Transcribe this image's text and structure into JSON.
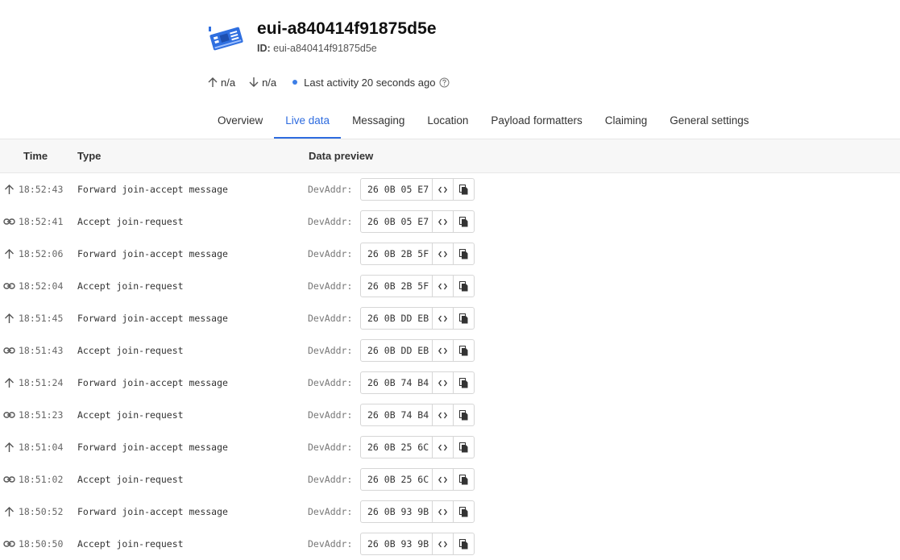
{
  "device": {
    "title": "eui-a840414f91875d5e",
    "id_label": "ID:",
    "id_value": "eui-a840414f91875d5e",
    "icon": "device-board-icon"
  },
  "stats": {
    "uplink": "n/a",
    "downlink": "n/a",
    "last_activity": "Last activity 20 seconds ago"
  },
  "tabs": [
    {
      "label": "Overview",
      "active": false
    },
    {
      "label": "Live data",
      "active": true
    },
    {
      "label": "Messaging",
      "active": false
    },
    {
      "label": "Location",
      "active": false
    },
    {
      "label": "Payload formatters",
      "active": false
    },
    {
      "label": "Claiming",
      "active": false
    },
    {
      "label": "General settings",
      "active": false
    }
  ],
  "table": {
    "headers": {
      "time": "Time",
      "type": "Type",
      "preview": "Data preview"
    },
    "rows": [
      {
        "icon": "arrow-up-icon",
        "time": "18:52:43",
        "type": "Forward join-accept message",
        "label": "DevAddr:",
        "addr": "26 0B 05 E7"
      },
      {
        "icon": "link-icon",
        "time": "18:52:41",
        "type": "Accept join-request",
        "label": "DevAddr:",
        "addr": "26 0B 05 E7"
      },
      {
        "icon": "arrow-up-icon",
        "time": "18:52:06",
        "type": "Forward join-accept message",
        "label": "DevAddr:",
        "addr": "26 0B 2B 5F"
      },
      {
        "icon": "link-icon",
        "time": "18:52:04",
        "type": "Accept join-request",
        "label": "DevAddr:",
        "addr": "26 0B 2B 5F"
      },
      {
        "icon": "arrow-up-icon",
        "time": "18:51:45",
        "type": "Forward join-accept message",
        "label": "DevAddr:",
        "addr": "26 0B DD EB"
      },
      {
        "icon": "link-icon",
        "time": "18:51:43",
        "type": "Accept join-request",
        "label": "DevAddr:",
        "addr": "26 0B DD EB"
      },
      {
        "icon": "arrow-up-icon",
        "time": "18:51:24",
        "type": "Forward join-accept message",
        "label": "DevAddr:",
        "addr": "26 0B 74 B4"
      },
      {
        "icon": "link-icon",
        "time": "18:51:23",
        "type": "Accept join-request",
        "label": "DevAddr:",
        "addr": "26 0B 74 B4"
      },
      {
        "icon": "arrow-up-icon",
        "time": "18:51:04",
        "type": "Forward join-accept message",
        "label": "DevAddr:",
        "addr": "26 0B 25 6C"
      },
      {
        "icon": "link-icon",
        "time": "18:51:02",
        "type": "Accept join-request",
        "label": "DevAddr:",
        "addr": "26 0B 25 6C"
      },
      {
        "icon": "arrow-up-icon",
        "time": "18:50:52",
        "type": "Forward join-accept message",
        "label": "DevAddr:",
        "addr": "26 0B 93 9B"
      },
      {
        "icon": "link-icon",
        "time": "18:50:50",
        "type": "Accept join-request",
        "label": "DevAddr:",
        "addr": "26 0B 93 9B"
      }
    ]
  },
  "colors": {
    "accent": "#2d6bdf",
    "device_icon": "#2f6fe0",
    "status_dot": "#3d7ee6"
  }
}
